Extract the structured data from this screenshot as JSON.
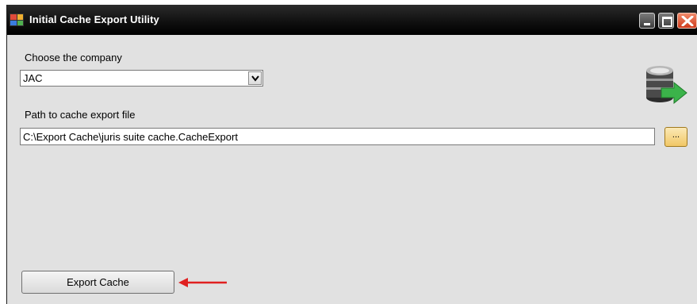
{
  "window": {
    "title": "Initial Cache Export Utility",
    "icon": "app-grid-icon",
    "controls": [
      "minimize-icon",
      "maximize-icon",
      "close-icon"
    ]
  },
  "company": {
    "label": "Choose the company",
    "selected": "JAC"
  },
  "path": {
    "label": "Path to cache export file",
    "value": "C:\\Export Cache\\juris suite cache.CacheExport",
    "browse_label": "..."
  },
  "actions": {
    "export_label": "Export Cache"
  },
  "decor": {
    "database_icon": "database-export-icon",
    "annotation": "red-arrow-icon"
  },
  "colors": {
    "titlebar": "#111111",
    "window_bg": "#e1e1e1",
    "close_button": "#d9482a",
    "browse_button": "#f1c766",
    "annotation_arrow": "#e02020"
  }
}
